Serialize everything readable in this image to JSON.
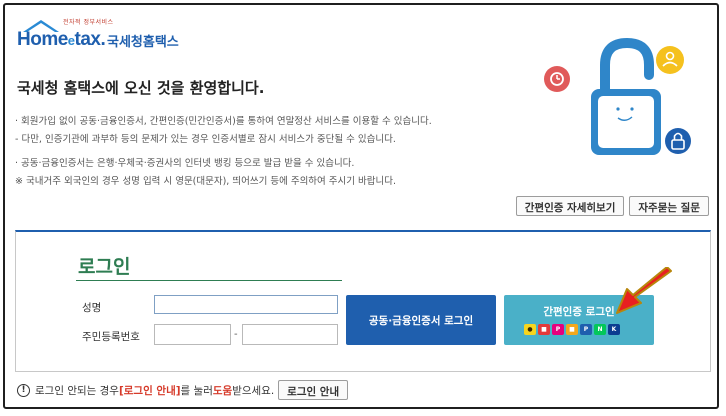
{
  "logo": {
    "small_text": "전자적 정부서비스",
    "main_text": "Home",
    "main_e": "e",
    "main_tail": "tax.",
    "sub_text": "국세청홈택스"
  },
  "welcome": "국세청 홈택스에 오신 것을 환영합니다.",
  "notes": [
    "· 회원가입 없이 공동·금융인증서, 간편인증(민간인증서)를 통하여 연말정산 서비스를 이용할 수 있습니다.",
    "  - 다만, 인증기관에 과부하 등의 문제가 있는 경우 인증서별로 잠시 서비스가 중단될 수 있습니다.",
    "· 공동·금융인증서는 은행·우체국·증권사의 인터넷 뱅킹 등으로 발급 받을 수 있습니다.",
    "  ※ 국내거주 외국인의 경우 성명 입력 시 영문(대문자), 띄어쓰기 등에 주의하여 주시기 바랍니다."
  ],
  "help_buttons": {
    "simple_auth_detail": "간편인증 자세히보기",
    "faq": "자주묻는 질문"
  },
  "login": {
    "title": "로그인",
    "name_label": "성명",
    "rrn_label": "주민등록번호",
    "rrn_dash": "-",
    "cert_login": "공동·금융인증서 로그인",
    "simple_login": "간편인증 로그인"
  },
  "footer": {
    "info_icon": "!",
    "text_before": "로그인 안되는 경우 ",
    "link_text": "[로그인 안내]",
    "text_middle": "를 눌러 ",
    "help_word": "도움",
    "text_after": "받으세요.",
    "button": "로그인 안내"
  },
  "colors": {
    "brand_blue": "#1f5fae",
    "login_green": "#2e7d52",
    "simple_teal": "#4ab0c8",
    "accent_red": "#d63a2a"
  }
}
